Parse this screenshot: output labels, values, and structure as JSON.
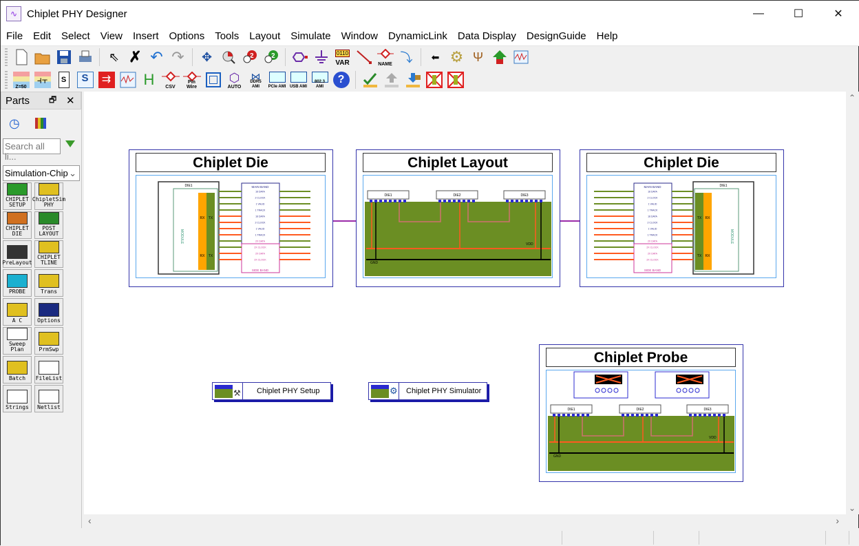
{
  "window": {
    "title": "Chiplet PHY Designer",
    "controls": [
      "minimize",
      "maximize",
      "close"
    ]
  },
  "menu": [
    "File",
    "Edit",
    "Select",
    "View",
    "Insert",
    "Options",
    "Tools",
    "Layout",
    "Simulate",
    "Window",
    "DynamicLink",
    "Data Display",
    "DesignGuide",
    "Help"
  ],
  "toolbar1": [
    {
      "icon": "new-file-icon"
    },
    {
      "icon": "open-folder-icon"
    },
    {
      "icon": "save-icon"
    },
    {
      "icon": "print-icon"
    },
    {
      "icon": "select-pointer-icon"
    },
    {
      "icon": "delete-icon"
    },
    {
      "icon": "undo-icon"
    },
    {
      "icon": "redo-icon"
    },
    {
      "icon": "pan-icon"
    },
    {
      "icon": "zoom-area-icon"
    },
    {
      "icon": "zoom-in-icon"
    },
    {
      "icon": "zoom-out-icon"
    },
    {
      "icon": "port-icon"
    },
    {
      "icon": "ground-icon"
    },
    {
      "icon": "var-icon",
      "label": "VAR"
    },
    {
      "icon": "wire-icon"
    },
    {
      "icon": "name-icon",
      "label": "NAME"
    },
    {
      "icon": "push-into-icon"
    },
    {
      "icon": "pop-out-icon"
    },
    {
      "icon": "settings-gear-icon"
    },
    {
      "icon": "tuning-fork-icon"
    },
    {
      "icon": "up-arrow-icon"
    },
    {
      "icon": "waveform-icon"
    }
  ],
  "toolbar2": [
    {
      "icon": "tline-z50-icon",
      "label": "Z=50"
    },
    {
      "icon": "coupled-line-icon"
    },
    {
      "icon": "s-param-icon",
      "label": "S"
    },
    {
      "icon": "s-param-check-icon",
      "label": "S"
    },
    {
      "icon": "export-icon"
    },
    {
      "icon": "s-plot-icon"
    },
    {
      "icon": "h-icon",
      "label": "H"
    },
    {
      "icon": "csv-icon",
      "label": "CSV"
    },
    {
      "icon": "pin-wire-icon",
      "label": "Pin Wire"
    },
    {
      "icon": "component-icon"
    },
    {
      "icon": "auto-icon",
      "label": "AUTO"
    },
    {
      "icon": "ddr5-ami-icon",
      "label": "DDR5 AMI"
    },
    {
      "icon": "pcie-ami-icon",
      "label": "PCIe AMI"
    },
    {
      "icon": "usb-ami-icon",
      "label": "USB AMI"
    },
    {
      "icon": "8023-ami-icon",
      "label": "802.3 AMI"
    },
    {
      "icon": "help-icon",
      "label": "?"
    },
    {
      "icon": "edit-symbol-icon"
    },
    {
      "icon": "upload-icon"
    },
    {
      "icon": "download-lock-icon"
    },
    {
      "icon": "deactivate-icon"
    },
    {
      "icon": "deactivate-short-icon"
    }
  ],
  "parts": {
    "title": "Parts",
    "search_placeholder": "Search all li...",
    "library": "Simulation-Chip",
    "items": [
      {
        "label": "CHIPLET SETUP"
      },
      {
        "label": "ChipletSim PHY"
      },
      {
        "label": "CHIPLET DIE"
      },
      {
        "label": "POST LAYOUT"
      },
      {
        "label": "PreLayout"
      },
      {
        "label": "CHIPLET TLINE"
      },
      {
        "label": "PROBE"
      },
      {
        "label": "Trans"
      },
      {
        "label": "A C"
      },
      {
        "label": "Options"
      },
      {
        "label": "Sweep Plan"
      },
      {
        "label": "PrmSwp"
      },
      {
        "label": "Batch"
      },
      {
        "label": "FileList"
      },
      {
        "label": "Strings"
      },
      {
        "label": "Netlist"
      }
    ]
  },
  "canvas": {
    "blocks": [
      {
        "title": "Chiplet Die",
        "die": "DIE1",
        "module": "MODULE",
        "main_band": "MAIN BAND",
        "side_band": "SIDE BAND",
        "signals": [
          "16 DATA",
          "2 CLOCK",
          "1 VALID",
          "1 TRACK",
          "16 DATA",
          "2 CLOCK",
          "1 VALID",
          "1 TRACK",
          "2X DATA",
          "2X CLOCK",
          "2X DATA",
          "2X CLOCK"
        ]
      },
      {
        "title": "Chiplet Layout",
        "dies": [
          "DIE1",
          "DIE2",
          "DIE3"
        ],
        "vdd": "VDD",
        "gnd": "GND"
      },
      {
        "title": "Chiplet Die",
        "die": "DIE1",
        "module": "MODULE",
        "main_band": "MAIN BAND",
        "side_band": "SIDE BAND"
      },
      {
        "title": "Chiplet Probe",
        "dies": [
          "DIE1",
          "DIE2",
          "DIE3"
        ],
        "vdd": "VDD",
        "gnd": "GND"
      }
    ],
    "refs": [
      {
        "label": "Chiplet PHY Setup"
      },
      {
        "label": "Chiplet PHY Simulator"
      }
    ],
    "rx": "RX",
    "tx": "TX"
  },
  "colors": {
    "green": "#6b8e23",
    "orange": "#ff5a1f",
    "amber": "#ffa500",
    "blue": "#3333aa",
    "pink": "#cc3399"
  }
}
